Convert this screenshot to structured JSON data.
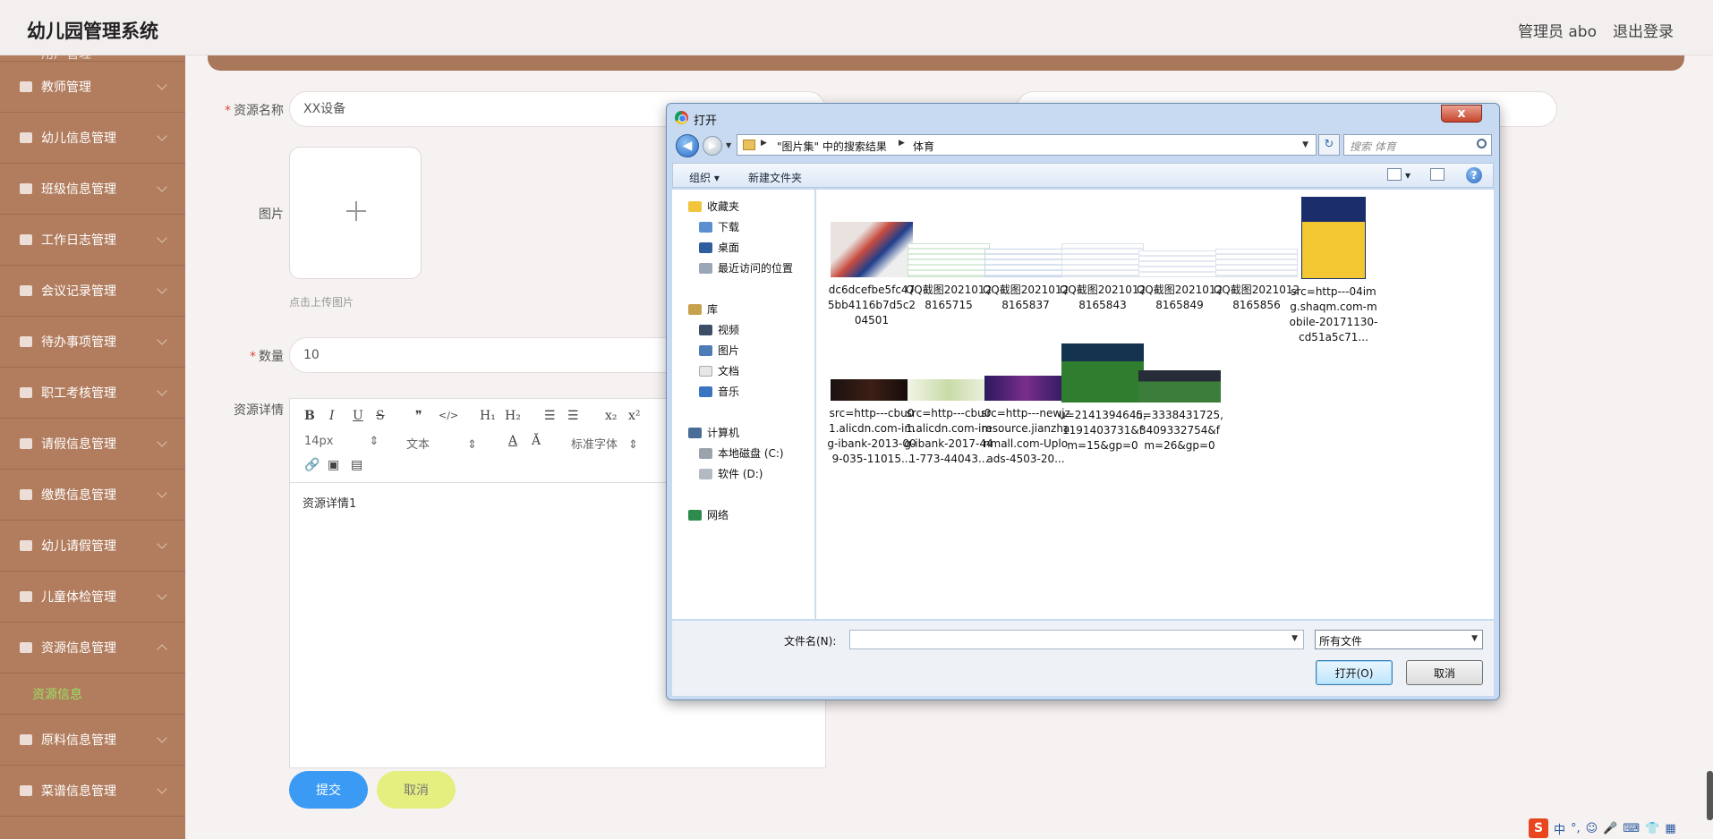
{
  "header": {
    "title": "幼儿园管理系统",
    "user": "管理员 abo",
    "logout": "退出登录"
  },
  "sidebar": {
    "partial_item": "用户管理",
    "items": [
      {
        "label": "教师管理"
      },
      {
        "label": "幼儿信息管理"
      },
      {
        "label": "班级信息管理"
      },
      {
        "label": "工作日志管理"
      },
      {
        "label": "会议记录管理"
      },
      {
        "label": "待办事项管理"
      },
      {
        "label": "职工考核管理"
      },
      {
        "label": "请假信息管理"
      },
      {
        "label": "缴费信息管理"
      },
      {
        "label": "幼儿请假管理"
      },
      {
        "label": "儿童体检管理"
      },
      {
        "label": "资源信息管理"
      }
    ],
    "sub_item": "资源信息",
    "items_after": [
      {
        "label": "原料信息管理"
      },
      {
        "label": "菜谱信息管理"
      }
    ]
  },
  "form": {
    "name_label": "资源名称",
    "name_value": "XX设备",
    "image_label": "图片",
    "upload_hint": "点击上传图片",
    "qty_label": "数量",
    "qty_value": "10",
    "detail_label": "资源详情",
    "detail_content": "资源详情1",
    "submit": "提交",
    "cancel": "取消"
  },
  "editor": {
    "bold": "B",
    "italic": "I",
    "underline": "U",
    "strike": "S",
    "quote": "❞",
    "code": "</>",
    "h1": "H₁",
    "h2": "H₂",
    "ol": "☰",
    "ul": "☰",
    "sub": "x₂",
    "sup": "x²",
    "font_size": "14px",
    "block_type": "文本",
    "font_family": "标准字体"
  },
  "dialog": {
    "title": "打开",
    "close": "x",
    "address_parts": [
      "\"图片集\" 中的搜索结果",
      "体育"
    ],
    "search_placeholder": "搜索 体育",
    "organize": "组织",
    "new_folder": "新建文件夹",
    "nav": {
      "favorites": "收藏夹",
      "downloads": "下载",
      "desktop": "桌面",
      "recent": "最近访问的位置",
      "libraries": "库",
      "videos": "视频",
      "pictures": "图片",
      "documents": "文档",
      "music": "音乐",
      "computer": "计算机",
      "drive_c": "本地磁盘 (C:)",
      "drive_d": "软件 (D:)",
      "network": "网络"
    },
    "files": [
      {
        "name": "dc6dcefbe5fc475bb4116b7d5c204501",
        "thumb": "basketball"
      },
      {
        "name": "QQ截图20210128165715",
        "thumb": "table-green"
      },
      {
        "name": "QQ截图20210128165837",
        "thumb": "table-blue"
      },
      {
        "name": "QQ截图20210128165843",
        "thumb": "table-light"
      },
      {
        "name": "QQ截图20210128165849",
        "thumb": "table-light"
      },
      {
        "name": "QQ截图20210128165856",
        "thumb": "table-light"
      },
      {
        "name": "src=http---04img.shaqm.com-mobile-20171130-cd51a5c71...",
        "thumb": "nba-poster"
      },
      {
        "name": "src=http---cbu01.alicdn.com-img-ibank-2013-009-035-11015...",
        "thumb": "dark-banner"
      },
      {
        "name": "src=http---cbu01.alicdn.com-img-ibank-2017-441-773-44043...",
        "thumb": "green-banner"
      },
      {
        "name": "src=http---newjzresource.jianzhanmall.com-Uploads-4503-20...",
        "thumb": "purple-banner"
      },
      {
        "name": "u=2141394645,1191403731&fm=15&gp=0",
        "thumb": "soccer"
      },
      {
        "name": "u=3338431725,3409332754&fm=26&gp=0",
        "thumb": "stadium"
      }
    ],
    "filename_label": "文件名(N):",
    "filename_value": "",
    "filetype": "所有文件",
    "open": "打开(O)",
    "cancel": "取消"
  },
  "tray": {
    "logo": "S",
    "ime": "中"
  },
  "colors": {
    "sidebar": "#b27d5e",
    "submit": "#3b9af4",
    "cancel": "#e4ef7f",
    "active_sub": "#9be063"
  }
}
